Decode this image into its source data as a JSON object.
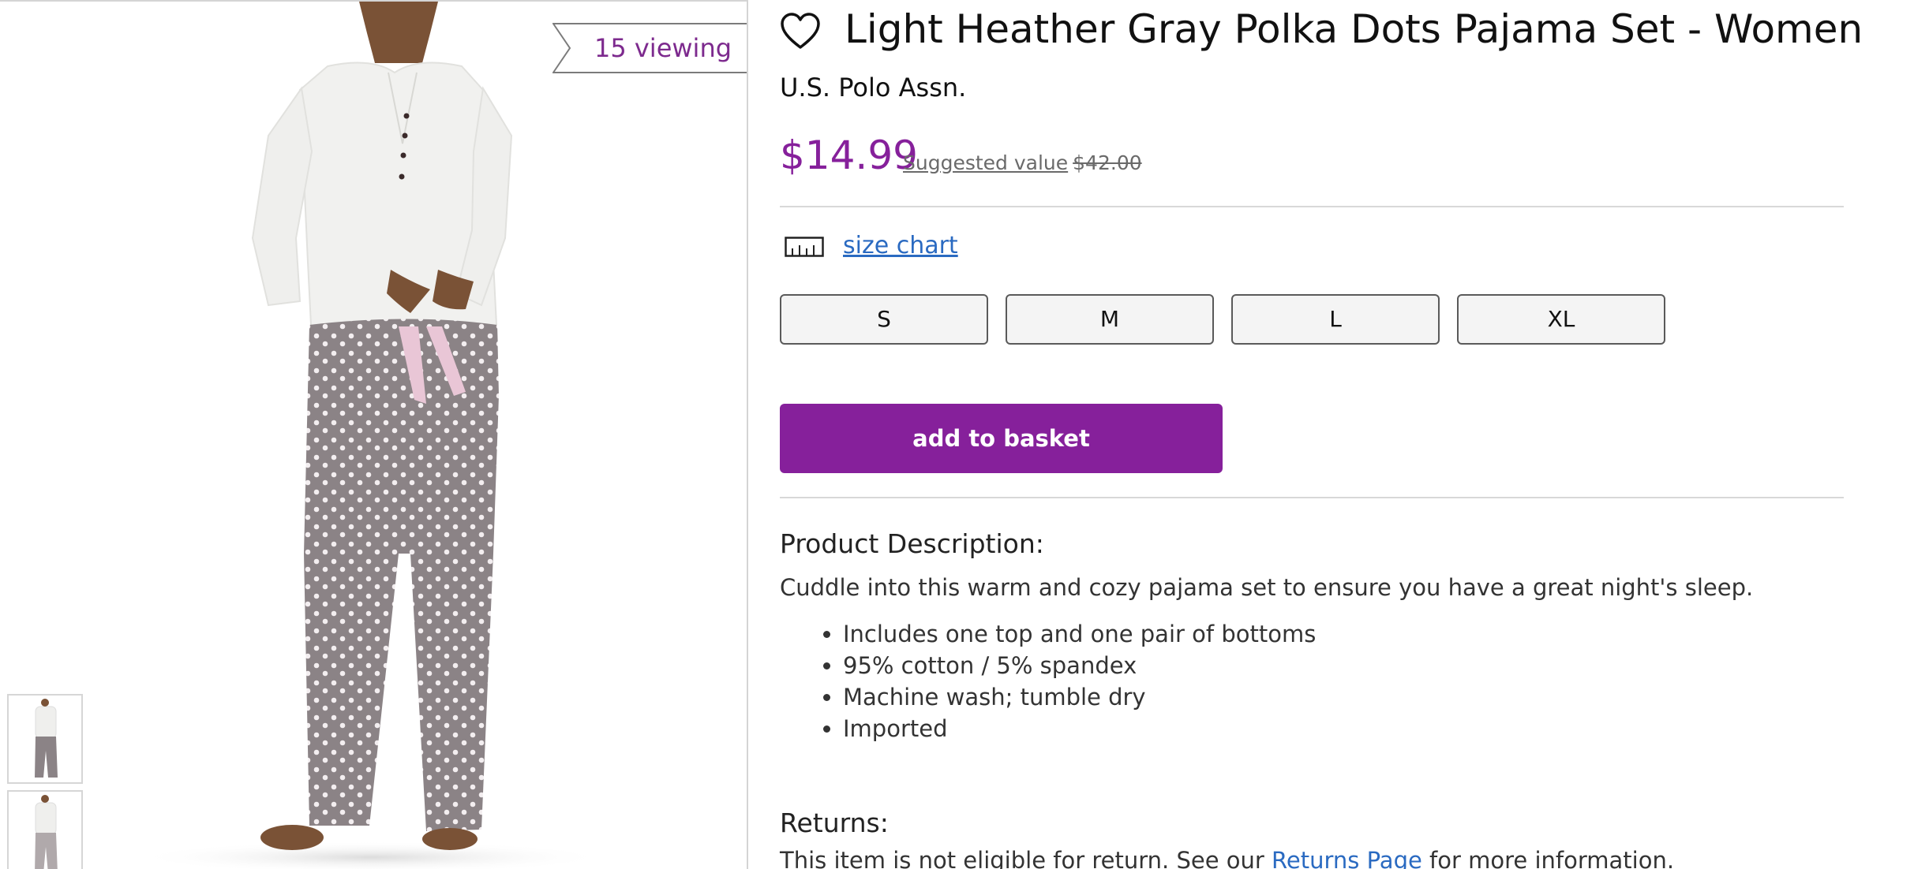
{
  "badge": {
    "text": "15 viewing"
  },
  "product": {
    "title": "Light Heather Gray Polka Dots Pajama Set - Women",
    "brand": "U.S. Polo Assn.",
    "price": "$14.99",
    "suggested_label": "Suggested value",
    "suggested_price": "$42.00"
  },
  "size_chart": {
    "label": "size chart"
  },
  "sizes": [
    "S",
    "M",
    "L",
    "XL"
  ],
  "basket": {
    "label": "add to basket"
  },
  "description": {
    "heading": "Product Description:",
    "text": "Cuddle into this warm and cozy pajama set to ensure you have a great night's sleep.",
    "bullets": [
      "Includes one top and one pair of bottoms",
      "95% cotton / 5% spandex",
      "Machine wash; tumble dry",
      "Imported"
    ]
  },
  "returns": {
    "heading": "Returns:",
    "text_before": "This item is not eligible for return. See our ",
    "link_label": "Returns Page",
    "text_after": " for more information."
  },
  "colors": {
    "accent": "#86209b",
    "link": "#2a6ac1",
    "badge_text": "#7d2a8e"
  }
}
